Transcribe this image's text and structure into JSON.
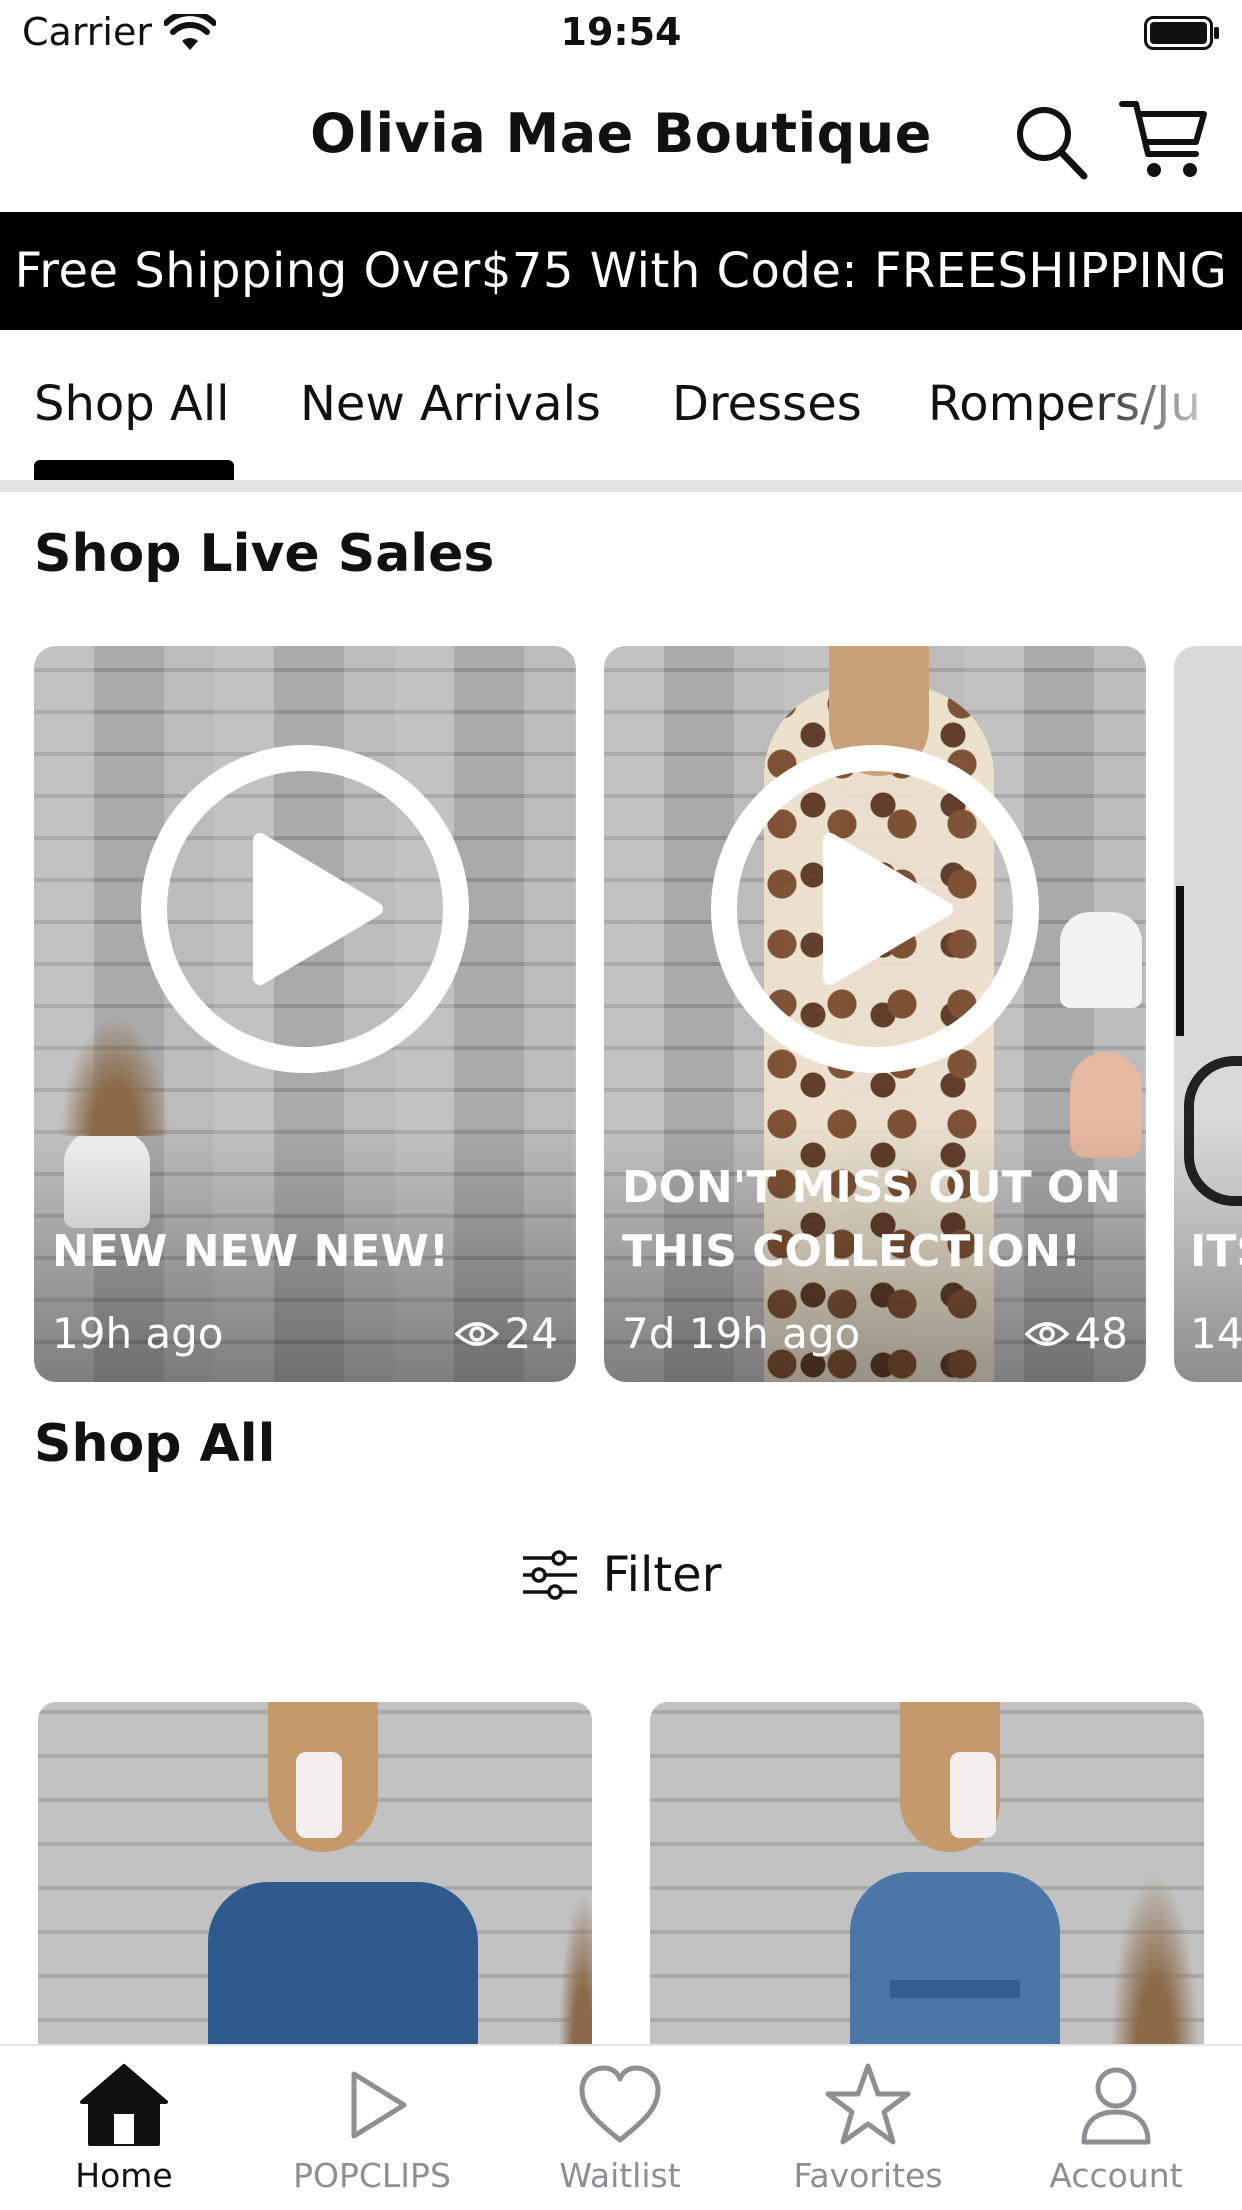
{
  "status_bar": {
    "carrier": "Carrier",
    "time": "19:54"
  },
  "header": {
    "title": "Olivia Mae Boutique"
  },
  "promo_banner": {
    "text": "Free Shipping Over$75 With Code: FREESHIPPING"
  },
  "category_tabs": [
    {
      "label": "Shop All",
      "selected": true
    },
    {
      "label": "New Arrivals",
      "selected": false
    },
    {
      "label": "Dresses",
      "selected": false
    },
    {
      "label": "Rompers/Ju",
      "selected": false
    }
  ],
  "live_sales": {
    "title": "Shop Live Sales",
    "cards": [
      {
        "caption": "NEW NEW NEW!",
        "time": "19h ago",
        "views": "24"
      },
      {
        "caption": "DON'T MISS OUT ON THIS COLLECTION!",
        "time": "7d 19h ago",
        "views": "48"
      },
      {
        "caption": "ITS SH",
        "time": "14"
      }
    ]
  },
  "shop_all": {
    "title": "Shop All",
    "filter_label": "Filter"
  },
  "bottom_nav": [
    {
      "label": "Home",
      "icon": "house-icon",
      "active": true
    },
    {
      "label": "POPCLIPS",
      "icon": "play-outline-icon",
      "active": false
    },
    {
      "label": "Waitlist",
      "icon": "heart-icon",
      "active": false
    },
    {
      "label": "Favorites",
      "icon": "star-icon",
      "active": false
    },
    {
      "label": "Account",
      "icon": "person-icon",
      "active": false
    }
  ],
  "colors": {
    "banner_bg": "#000000",
    "banner_text": "#ffffff",
    "inactive_nav": "#8e8e93",
    "tab_divider": "#e3e3e3"
  }
}
